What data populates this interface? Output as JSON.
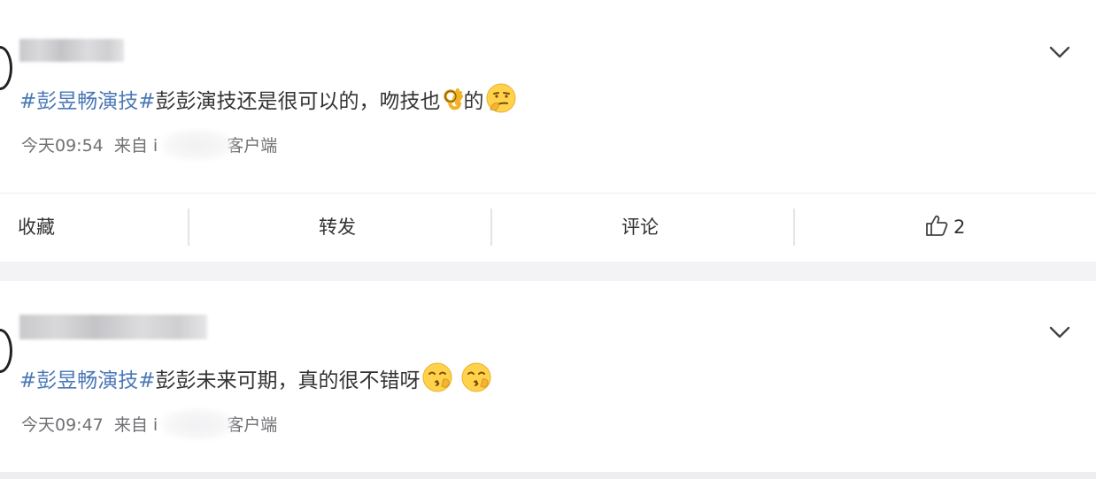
{
  "posts": [
    {
      "topic": "#彭昱畅演技#",
      "text": "彭彭演技还是很可以的，吻技也",
      "emoji_mid": "ok-hand-emoji",
      "text_after": "的",
      "emoji_end": "smirk-thinking-emoji",
      "time": "今天09:54",
      "source_prefix": "来自 i",
      "source_suffix": "客户端"
    },
    {
      "topic": "#彭昱畅演技#",
      "text": "彭彭未来可期，真的很不错呀",
      "emoji_end": "kissing-emoji",
      "time": "今天09:47",
      "source_prefix": "来自 i",
      "source_suffix": "客户端"
    }
  ],
  "actions": {
    "collect": "收藏",
    "repost": "转发",
    "comment": "评论",
    "like_count": "2"
  },
  "colors": {
    "topic": "#4a78b6",
    "meta": "#707075",
    "page_bg": "#f3f3f6"
  }
}
